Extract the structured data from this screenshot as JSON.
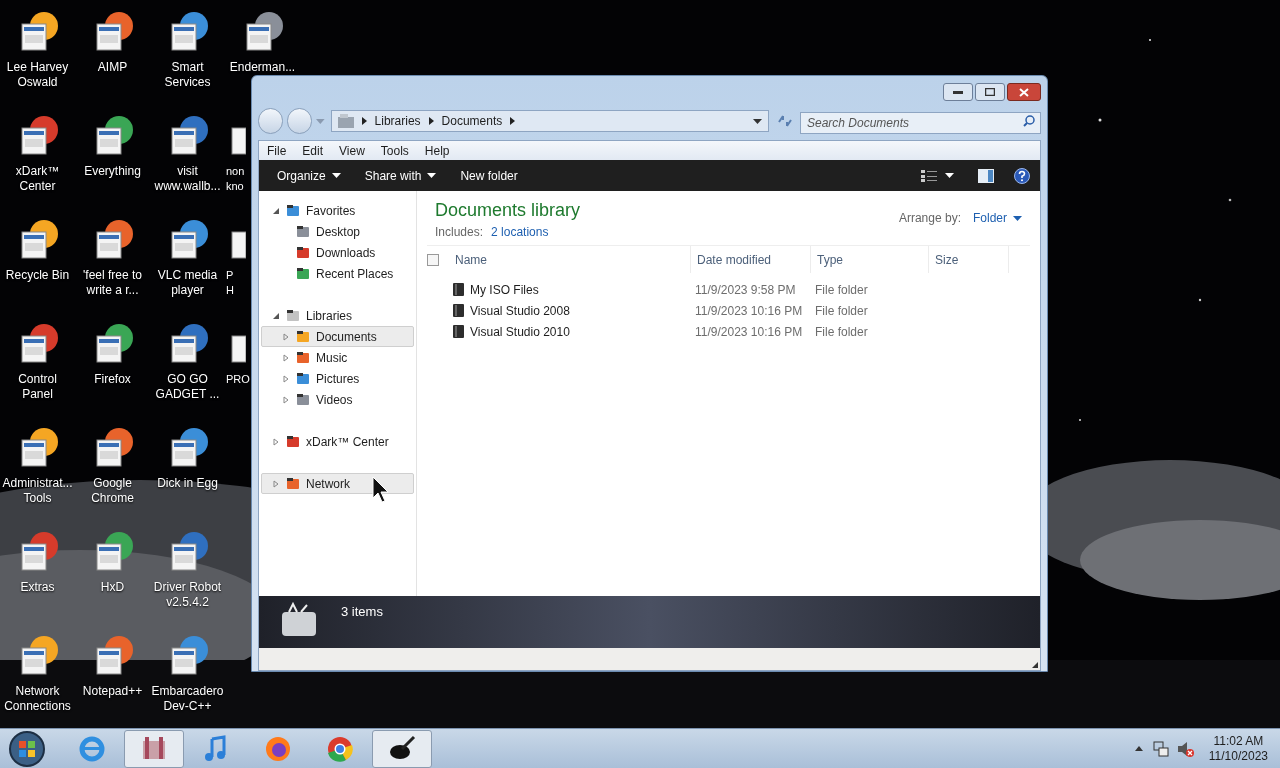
{
  "desktop": {
    "icon_rows": [
      [
        {
          "lines": [
            "Lee Harvey",
            "Oswald"
          ]
        },
        {
          "lines": [
            "AIMP"
          ]
        },
        {
          "lines": [
            "Smart",
            "Services"
          ]
        },
        {
          "lines": [
            "Enderman..."
          ]
        }
      ],
      [
        {
          "lines": [
            "xDark™",
            "Center"
          ]
        },
        {
          "lines": [
            "Everything"
          ]
        },
        {
          "lines": [
            "visit",
            "www.wallb..."
          ]
        },
        {
          "lines": [
            "non",
            "kno"
          ]
        }
      ],
      [
        {
          "lines": [
            "Recycle Bin"
          ]
        },
        {
          "lines": [
            "'feel free to",
            "write a r..."
          ]
        },
        {
          "lines": [
            "VLC media",
            "player"
          ]
        },
        {
          "lines": [
            "P",
            "H"
          ]
        }
      ],
      [
        {
          "lines": [
            "Control",
            "Panel"
          ]
        },
        {
          "lines": [
            "Firefox"
          ]
        },
        {
          "lines": [
            "GO GO",
            "GADGET ..."
          ]
        },
        {
          "lines": [
            "PRO"
          ]
        }
      ],
      [
        {
          "lines": [
            "Administrat...",
            "Tools"
          ]
        },
        {
          "lines": [
            "Google",
            "Chrome"
          ]
        },
        {
          "lines": [
            "Dick in Egg"
          ]
        }
      ],
      [
        {
          "lines": [
            "Extras"
          ]
        },
        {
          "lines": [
            "HxD"
          ]
        },
        {
          "lines": [
            "Driver Robot",
            "v2.5.4.2"
          ]
        }
      ],
      [
        {
          "lines": [
            "Network",
            "Connections"
          ]
        },
        {
          "lines": [
            "Notepad++"
          ]
        },
        {
          "lines": [
            "Embarcadero",
            "Dev-C++"
          ]
        }
      ]
    ]
  },
  "explorer": {
    "address": [
      "Libraries",
      "Documents"
    ],
    "search": {
      "placeholder": "Search Documents"
    },
    "menu": [
      "File",
      "Edit",
      "View",
      "Tools",
      "Help"
    ],
    "toolbar": [
      {
        "label": "Organize",
        "dropdown": true
      },
      {
        "label": "Share with",
        "dropdown": true
      },
      {
        "label": "New folder",
        "dropdown": false
      }
    ],
    "nav": [
      {
        "label": "Favorites",
        "expanded": true,
        "highlighted": false,
        "children": [
          {
            "label": "Desktop",
            "highlighted": false
          },
          {
            "label": "Downloads",
            "highlighted": false
          },
          {
            "label": "Recent Places",
            "highlighted": false
          }
        ]
      },
      {
        "label": "Libraries",
        "expanded": true,
        "highlighted": false,
        "children": [
          {
            "label": "Documents",
            "highlighted": true,
            "expanded": false
          },
          {
            "label": "Music",
            "highlighted": false,
            "expanded": false
          },
          {
            "label": "Pictures",
            "highlighted": false,
            "expanded": false
          },
          {
            "label": "Videos",
            "highlighted": false,
            "expanded": false
          }
        ]
      },
      {
        "label": "xDark™ Center",
        "expanded": false,
        "highlighted": false
      },
      {
        "label": "Network",
        "expanded": false,
        "highlighted": true
      }
    ],
    "content": {
      "title": "Documents library",
      "includes_label": "Includes:",
      "includes_link": "2 locations",
      "arrange_label": "Arrange by:",
      "arrange_value": "Folder",
      "select_all_checked": false,
      "columns": [
        "Name",
        "Date modified",
        "Type",
        "Size"
      ],
      "rows": [
        {
          "name": "My ISO Files",
          "date": "11/9/2023 9:58 PM",
          "type": "File folder"
        },
        {
          "name": "Visual Studio 2008",
          "date": "11/9/2023 10:16 PM",
          "type": "File folder"
        },
        {
          "name": "Visual Studio 2010",
          "date": "11/9/2023 10:16 PM",
          "type": "File folder"
        }
      ]
    },
    "status": "3 items"
  },
  "taskbar": {
    "items": [
      {
        "selected": false
      },
      {
        "selected": true
      },
      {
        "selected": false
      },
      {
        "selected": false
      },
      {
        "selected": false
      },
      {
        "selected": true
      }
    ],
    "time": "11:02 AM",
    "date": "11/10/2023"
  }
}
